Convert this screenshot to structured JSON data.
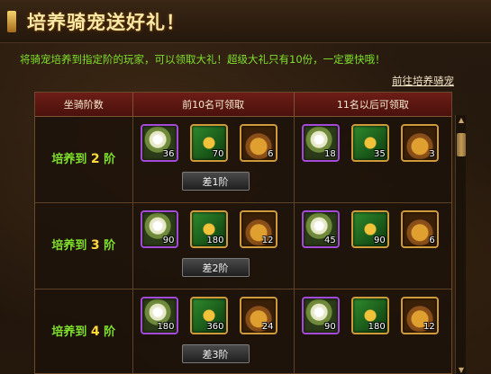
{
  "title": "培养骑宠送好礼！",
  "notice": "将骑宠培养到指定阶的玩家，可以领取大礼！超级大礼只有10份，一定要快哦！",
  "goto_link": "前往培养骑宠",
  "table": {
    "headers": [
      "坐骑阶数",
      "前10名可领取",
      "11名以后可领取"
    ],
    "rows": [
      {
        "label_prefix": "培养到",
        "level": "2",
        "label_suffix": "阶",
        "first10": [
          {
            "icon": "white-flower-icon",
            "qty": "36"
          },
          {
            "icon": "green-horseshoe-book-icon",
            "qty": "70"
          },
          {
            "icon": "gold-coin-bag-icon",
            "qty": "6"
          }
        ],
        "after10": [
          {
            "icon": "white-flower-icon",
            "qty": "18"
          },
          {
            "icon": "green-horseshoe-book-icon",
            "qty": "35"
          },
          {
            "icon": "gold-coin-bag-icon",
            "qty": "3"
          }
        ],
        "diff": "差1阶"
      },
      {
        "label_prefix": "培养到",
        "level": "3",
        "label_suffix": "阶",
        "first10": [
          {
            "icon": "white-flower-icon",
            "qty": "90"
          },
          {
            "icon": "green-horseshoe-book-icon",
            "qty": "180"
          },
          {
            "icon": "gold-coin-bag-icon",
            "qty": "12"
          }
        ],
        "after10": [
          {
            "icon": "white-flower-icon",
            "qty": "45"
          },
          {
            "icon": "green-horseshoe-book-icon",
            "qty": "90"
          },
          {
            "icon": "gold-coin-bag-icon",
            "qty": "6"
          }
        ],
        "diff": "差2阶"
      },
      {
        "label_prefix": "培养到",
        "level": "4",
        "label_suffix": "阶",
        "first10": [
          {
            "icon": "white-flower-icon",
            "qty": "180"
          },
          {
            "icon": "green-horseshoe-book-icon",
            "qty": "360"
          },
          {
            "icon": "gold-coin-bag-icon",
            "qty": "24"
          }
        ],
        "after10": [
          {
            "icon": "white-flower-icon",
            "qty": "90"
          },
          {
            "icon": "green-horseshoe-book-icon",
            "qty": "180"
          },
          {
            "icon": "gold-coin-bag-icon",
            "qty": "12"
          }
        ],
        "diff": "差3阶"
      }
    ]
  },
  "colors": {
    "accent_green": "#7ee02a",
    "level_yellow": "#ffd83a",
    "header_red": "#6d1d17",
    "rarity_purple": "#a34ad8",
    "rarity_gold": "#cf9a3a"
  }
}
